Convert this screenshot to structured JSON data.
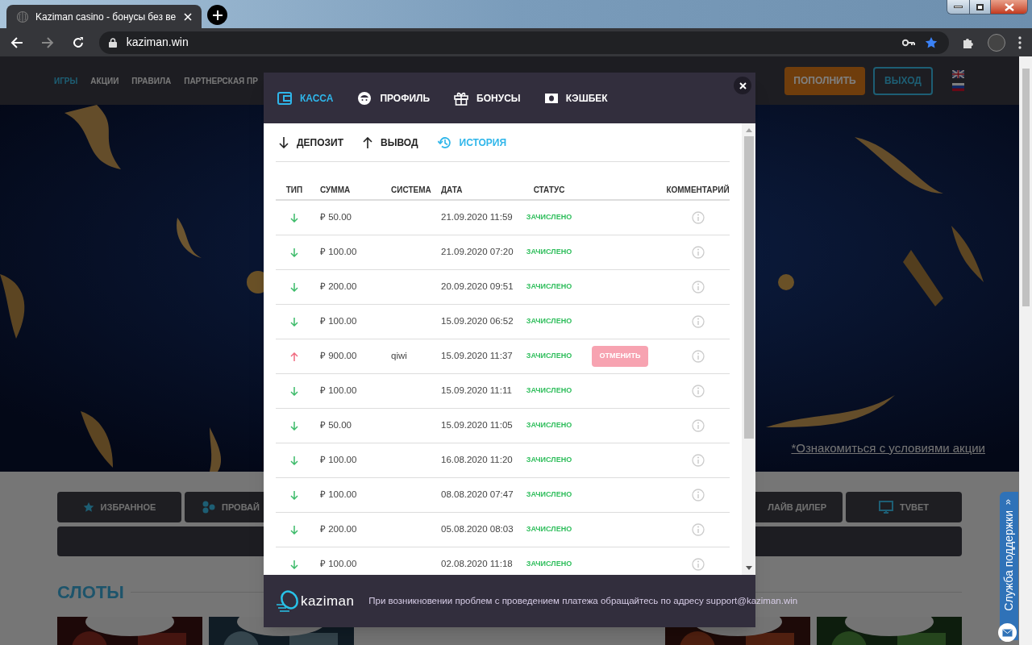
{
  "browser": {
    "tab_title": "Kaziman casino - бонусы без ве",
    "url": "kaziman.win"
  },
  "site": {
    "nav": [
      {
        "label": "ИГРЫ",
        "selected": true
      },
      {
        "label": "АКЦИИ",
        "selected": false
      },
      {
        "label": "ПРАВИЛА",
        "selected": false
      },
      {
        "label": "ПАРТНЕРСКАЯ ПР",
        "selected": false
      }
    ],
    "deposit_button": "ПОПОЛНИТЬ",
    "logout_button": "ВЫХОД",
    "promo_link": "*Ознакомиться с условиями акции",
    "categories": [
      "ИЗБРАННОЕ",
      "ПРОВАЙ",
      "ЛАЙВ ДИЛЕР",
      "TVBET"
    ],
    "slots_title": "СЛОТЫ",
    "support_label": "Служба поддержки",
    "support_toggle": "«"
  },
  "modal": {
    "tabs": [
      {
        "label": "КАССА",
        "selected": true
      },
      {
        "label": "ПРОФИЛЬ",
        "selected": false
      },
      {
        "label": "БОНУСЫ",
        "selected": false
      },
      {
        "label": "КЭШБЕК",
        "selected": false
      }
    ],
    "subtabs": [
      {
        "label": "ДЕПОЗИТ",
        "selected": false
      },
      {
        "label": "ВЫВОД",
        "selected": false
      },
      {
        "label": "ИСТОРИЯ",
        "selected": true
      }
    ],
    "columns": [
      "ТИП",
      "СУММА",
      "СИСТЕМА",
      "ДАТА",
      "СТАТУС",
      "КОММЕНТАРИЙ"
    ],
    "rows": [
      {
        "kind": "deposit",
        "amount": "₽ 50.00",
        "date": "21.09.2020 11:59",
        "status": "ЗАЧИСЛЕНО"
      },
      {
        "kind": "deposit",
        "amount": "₽ 100.00",
        "date": "21.09.2020 07:20",
        "status": "ЗАЧИСЛЕНО"
      },
      {
        "kind": "deposit",
        "amount": "₽ 200.00",
        "date": "20.09.2020 09:51",
        "status": "ЗАЧИСЛЕНО"
      },
      {
        "kind": "deposit",
        "amount": "₽ 100.00",
        "date": "15.09.2020 06:52",
        "status": "ЗАЧИСЛЕНО"
      },
      {
        "kind": "withdrawal",
        "amount": "₽ 900.00",
        "system": "qiwi",
        "date": "15.09.2020 11:37",
        "status": "ЗАЧИСЛЕНО",
        "action": "ОТМЕНИТЬ"
      },
      {
        "kind": "deposit",
        "amount": "₽ 100.00",
        "date": "15.09.2020 11:11",
        "status": "ЗАЧИСЛЕНО"
      },
      {
        "kind": "deposit",
        "amount": "₽ 50.00",
        "date": "15.09.2020 11:05",
        "status": "ЗАЧИСЛЕНО"
      },
      {
        "kind": "deposit",
        "amount": "₽ 100.00",
        "date": "16.08.2020 11:20",
        "status": "ЗАЧИСЛЕНО"
      },
      {
        "kind": "deposit",
        "amount": "₽ 100.00",
        "date": "08.08.2020 07:47",
        "status": "ЗАЧИСЛЕНО"
      },
      {
        "kind": "deposit",
        "amount": "₽ 200.00",
        "date": "05.08.2020 08:03",
        "status": "ЗАЧИСЛЕНО"
      },
      {
        "kind": "deposit",
        "amount": "₽ 100.00",
        "date": "02.08.2020 11:18",
        "status": "ЗАЧИСЛЕНО"
      }
    ],
    "logo": "kaziman",
    "footer_text": "При возникновении проблем с проведением платежа обращайтесь по адресу support@kaziman.win"
  }
}
